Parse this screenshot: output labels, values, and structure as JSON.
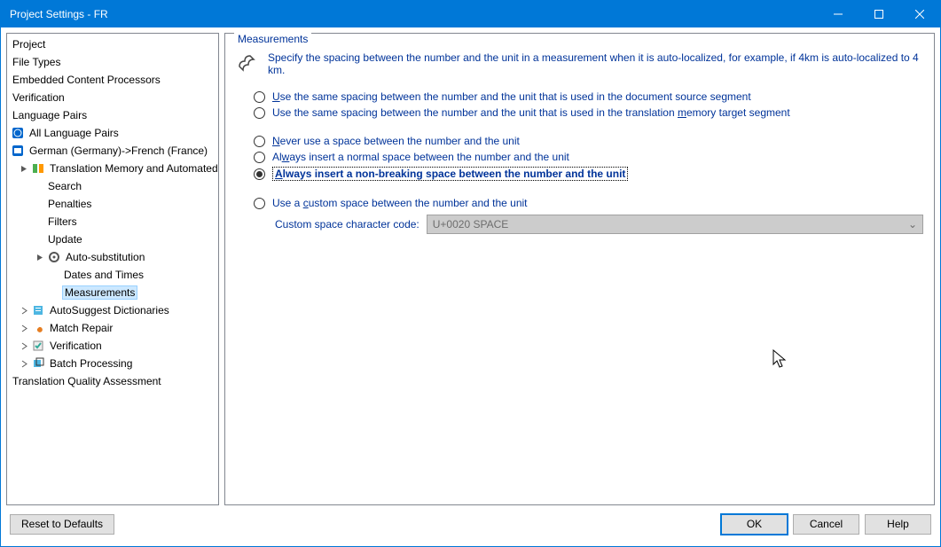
{
  "window": {
    "title": "Project Settings - FR"
  },
  "tree": {
    "items": [
      "Project",
      "File Types",
      "Embedded Content Processors",
      "Verification",
      "Language Pairs",
      "All Language Pairs",
      "German (Germany)->French (France)",
      "Translation Memory and Automated Translation",
      "Search",
      "Penalties",
      "Filters",
      "Update",
      "Auto-substitution",
      "Dates and Times",
      "Measurements",
      "AutoSuggest Dictionaries",
      "Match Repair",
      "Verification",
      "Batch Processing",
      "Translation Quality Assessment"
    ]
  },
  "panel": {
    "heading": "Measurements",
    "intro": "Specify the spacing between the number and the unit in a measurement when it is auto-localized, for example, if 4km is auto-localized to 4 km.",
    "radios": {
      "r1_pre": "",
      "r1_mn": "U",
      "r1_post": "se the same spacing between the number and the unit that is used in the document source segment",
      "r2_pre": "Use the same spacing between the number and the unit that is used in the translation ",
      "r2_mn": "m",
      "r2_post": "emory target segment",
      "r3_pre": "",
      "r3_mn": "N",
      "r3_post": "ever use a space between the number and the unit",
      "r4_pre": "Al",
      "r4_mn": "w",
      "r4_post": "ays insert a normal space between the number and the unit",
      "r5_pre": "",
      "r5_mn": "A",
      "r5_post": "lways insert a non-breaking space between the number and the unit",
      "r6_pre": "Use a ",
      "r6_mn": "c",
      "r6_post": "ustom space between the number and the unit"
    },
    "custom_label": "Custom space character code:",
    "custom_value": "U+0020 SPACE"
  },
  "footer": {
    "reset": "Reset to Defaults",
    "ok": "OK",
    "cancel": "Cancel",
    "help": "Help"
  }
}
